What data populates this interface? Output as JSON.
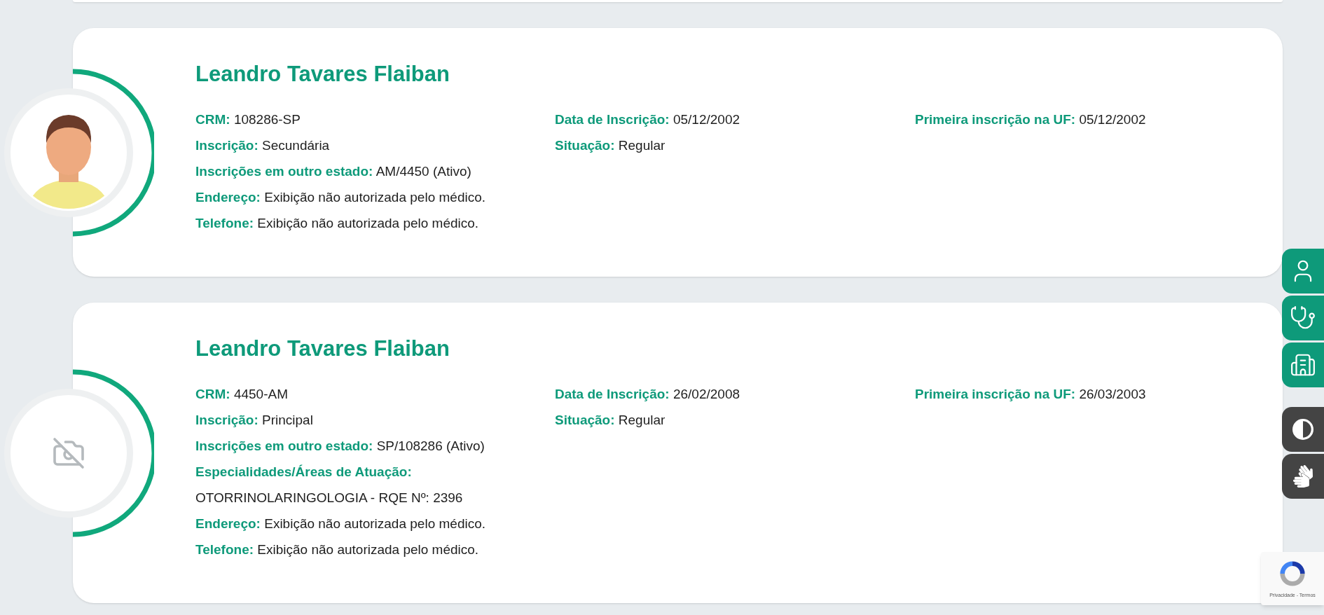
{
  "doctors": [
    {
      "name": "Leandro Tavares Flaiban",
      "photo": {
        "kind": "picture"
      },
      "columns": [
        [
          {
            "kind": "pair",
            "label": "CRM:",
            "value": "108286-SP"
          },
          {
            "kind": "pair",
            "label": "Inscrição:",
            "value": "Secundária"
          },
          {
            "kind": "pair",
            "label": "Inscrições em outro estado:",
            "value": "AM/4450 (Ativo)"
          },
          {
            "kind": "pair",
            "label": "Endereço:",
            "value": "Exibição não autorizada pelo médico."
          },
          {
            "kind": "pair",
            "label": "Telefone:",
            "value": "Exibição não autorizada pelo médico."
          }
        ],
        [
          {
            "kind": "pair",
            "label": "Data de Inscrição:",
            "value": "05/12/2002"
          },
          {
            "kind": "pair",
            "label": "Situação:",
            "value": "Regular"
          }
        ],
        [
          {
            "kind": "pair",
            "label": "Primeira inscrição na UF:",
            "value": "05/12/2002"
          }
        ]
      ]
    },
    {
      "name": "Leandro Tavares Flaiban",
      "photo": {
        "kind": "none"
      },
      "columns": [
        [
          {
            "kind": "pair",
            "label": "CRM:",
            "value": "4450-AM"
          },
          {
            "kind": "pair",
            "label": "Inscrição:",
            "value": "Principal"
          },
          {
            "kind": "pair",
            "label": "Inscrições em outro estado:",
            "value": "SP/108286 (Ativo)"
          },
          {
            "kind": "heading",
            "label": "Especialidades/Áreas de Atuação:"
          },
          {
            "kind": "text",
            "value": "OTORRINOLARINGOLOGIA - RQE Nº: 2396"
          },
          {
            "kind": "pair",
            "label": "Endereço:",
            "value": "Exibição não autorizada pelo médico."
          },
          {
            "kind": "pair",
            "label": "Telefone:",
            "value": "Exibição não autorizada pelo médico."
          }
        ],
        [
          {
            "kind": "pair",
            "label": "Data de Inscrição:",
            "value": "26/02/2008"
          },
          {
            "kind": "pair",
            "label": "Situação:",
            "value": "Regular"
          }
        ],
        [
          {
            "kind": "pair",
            "label": "Primeira inscrição na UF:",
            "value": "26/03/2003"
          }
        ]
      ]
    }
  ],
  "side_buttons": [
    {
      "kind": "profile"
    },
    {
      "kind": "doctor"
    },
    {
      "kind": "building"
    },
    {
      "kind": "contrast"
    },
    {
      "kind": "sign_language"
    }
  ],
  "recaptcha": {
    "links": "Privacidade - Termos"
  }
}
